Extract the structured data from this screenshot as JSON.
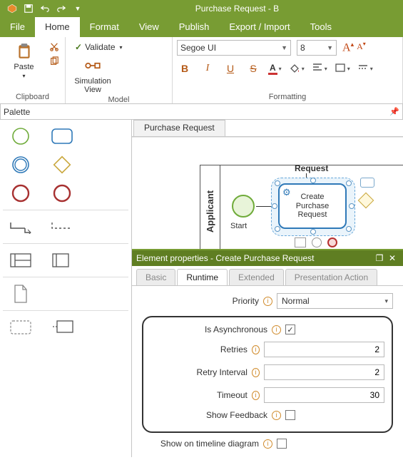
{
  "window": {
    "title": "Purchase Request - B"
  },
  "menu": {
    "file": "File",
    "home": "Home",
    "format": "Format",
    "view": "View",
    "publish": "Publish",
    "export": "Export / Import",
    "tools": "Tools"
  },
  "ribbon": {
    "clipboard": {
      "paste": "Paste",
      "group": "Clipboard"
    },
    "model": {
      "sim": "Simulation View",
      "validate": "Validate",
      "group": "Model"
    },
    "formatting": {
      "font": "Segoe UI",
      "size": "8",
      "bold": "B",
      "italic": "I",
      "under": "U",
      "strike": "S",
      "group": "Formatting"
    }
  },
  "palette": {
    "title": "Palette"
  },
  "doc": {
    "tab": "Purchase Request"
  },
  "diagram": {
    "lane": "Applicant",
    "start": "Start",
    "request": "Request",
    "task_l1": "Create",
    "task_l2": "Purchase",
    "task_l3": "Request"
  },
  "props": {
    "title": "Element properties - Create Purchase Request",
    "tabs": {
      "basic": "Basic",
      "runtime": "Runtime",
      "extended": "Extended",
      "pres": "Presentation Action"
    },
    "priority_label": "Priority",
    "priority_value": "Normal",
    "async_label": "Is Asynchronous",
    "async_checked": "✓",
    "retries_label": "Retries",
    "retries_value": "2",
    "interval_label": "Retry Interval",
    "interval_value": "2",
    "timeout_label": "Timeout",
    "timeout_value": "30",
    "feedback_label": "Show Feedback",
    "timeline_label": "Show on timeline diagram"
  }
}
